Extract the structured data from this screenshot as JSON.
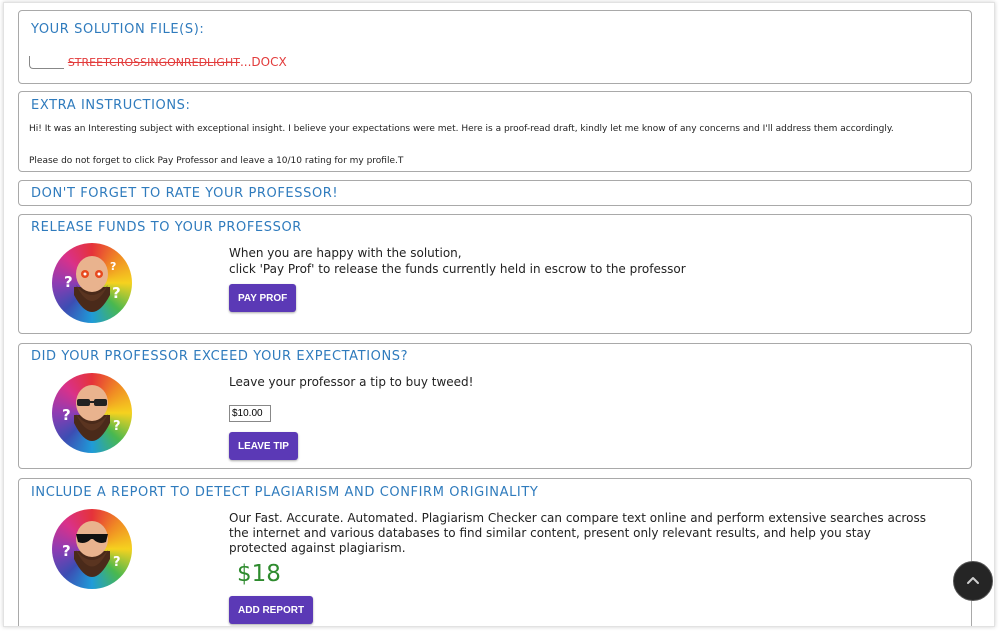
{
  "solution": {
    "heading": "YOUR SOLUTION FILE(S):",
    "file_name": "STREETCROSSINGONREDLIGHT",
    "file_ext": "...DOCX"
  },
  "extra": {
    "heading": "EXTRA INSTRUCTIONS:",
    "line1": "Hi! It was an Interesting subject with exceptional insight. I believe your expectations were met. Here is a proof-read draft, kindly let me know of any concerns and I'll address them accordingly.",
    "line2": "Please do not forget to click Pay Professor and leave a 10/10 rating for my profile.T"
  },
  "rate": {
    "heading": "DON'T FORGET TO RATE YOUR PROFESSOR!"
  },
  "release": {
    "heading": "RELEASE FUNDS TO YOUR PROFESSOR",
    "line1": "When you are happy with the solution,",
    "line2": "click 'Pay Prof' to release the funds currently held in escrow to the professor",
    "button": "PAY PROF"
  },
  "tip": {
    "heading": "DID YOUR PROFESSOR EXCEED YOUR EXPECTATIONS?",
    "text": "Leave your professor a tip to buy tweed!",
    "input_value": "$10.00",
    "button": "LEAVE TIP"
  },
  "report": {
    "heading": "INCLUDE A REPORT TO DETECT PLAGIARISM AND CONFIRM ORIGINALITY",
    "text": "Our Fast. Accurate. Automated. Plagiarism Checker can compare text online and perform extensive searches across the internet and various databases to find similar content, present only relevant results, and help you stay protected against plagiarism.",
    "price": "$18",
    "button": "ADD REPORT"
  },
  "icons": {
    "avatar": "bald-bearded-professor-avatar",
    "scroll_top": "chevron-up-icon"
  }
}
